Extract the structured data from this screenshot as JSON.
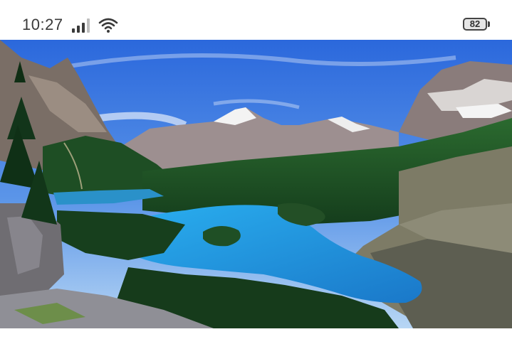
{
  "status_bar": {
    "time": "10:27",
    "battery_level": "82",
    "icons": [
      "signal-icon",
      "wifi-icon",
      "battery-icon"
    ]
  },
  "colors": {
    "sky_top": "#2d6fe0",
    "sky_bottom": "#a9cdf2",
    "lake": "#1f9ae0",
    "forest": "#1b4a24",
    "rock": "#8a7e7a"
  }
}
